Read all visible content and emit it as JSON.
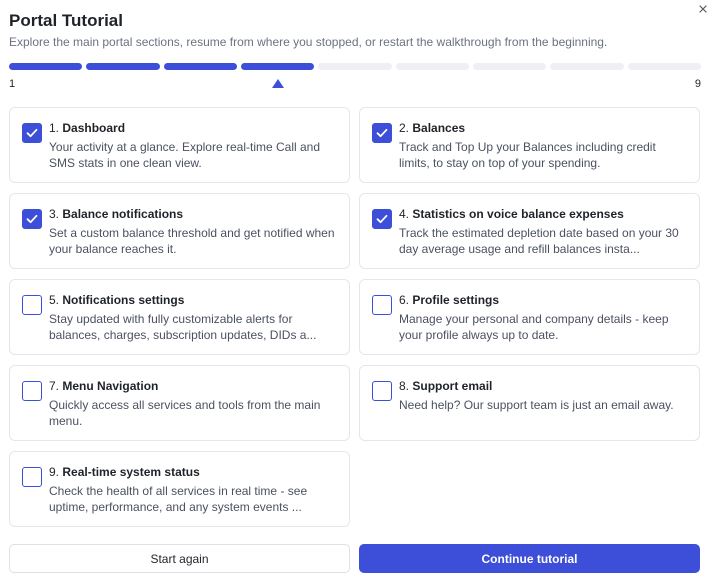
{
  "dialog": {
    "title": "Portal Tutorial",
    "subtitle": "Explore the main portal sections, resume from where you stopped, or restart the walkthrough from the beginning."
  },
  "progress": {
    "total_steps": 9,
    "completed_steps": 4,
    "current_step": 4,
    "min_label": "1",
    "max_label": "9",
    "accent_color": "#3d4ed9",
    "track_color": "#eef0f6"
  },
  "steps": [
    {
      "num": "1.",
      "name": "Dashboard",
      "desc": "Your activity at a glance. Explore real-time Call and SMS stats in one clean view.",
      "checked": true
    },
    {
      "num": "2.",
      "name": "Balances",
      "desc": "Track and Top Up your Balances including credit limits, to stay on top of your spending.",
      "checked": true
    },
    {
      "num": "3.",
      "name": "Balance notifications",
      "desc": "Set a custom balance threshold and get notified when your balance reaches it.",
      "checked": true
    },
    {
      "num": "4.",
      "name": "Statistics on voice balance expenses",
      "desc": "Track the estimated depletion date based on your 30 day average usage and refill balances insta...",
      "checked": true
    },
    {
      "num": "5.",
      "name": "Notifications settings",
      "desc": "Stay updated with fully customizable alerts for balances, charges, subscription updates, DIDs a...",
      "checked": false
    },
    {
      "num": "6.",
      "name": "Profile settings",
      "desc": "Manage your personal and company details - keep your profile always up to date.",
      "checked": false
    },
    {
      "num": "7.",
      "name": "Menu Navigation",
      "desc": "Quickly access all services and tools from the main menu.",
      "checked": false
    },
    {
      "num": "8.",
      "name": "Support email",
      "desc": "Need help? Our support team is just an email away.",
      "checked": false
    },
    {
      "num": "9.",
      "name": "Real-time system status",
      "desc": "Check the health of all services in real time - see uptime, performance, and any system events ...",
      "checked": false
    }
  ],
  "buttons": {
    "start_again": "Start again",
    "continue": "Continue tutorial"
  },
  "icons": {
    "close": "close-icon",
    "check": "checkmark-icon",
    "marker": "triangle-up-icon"
  }
}
